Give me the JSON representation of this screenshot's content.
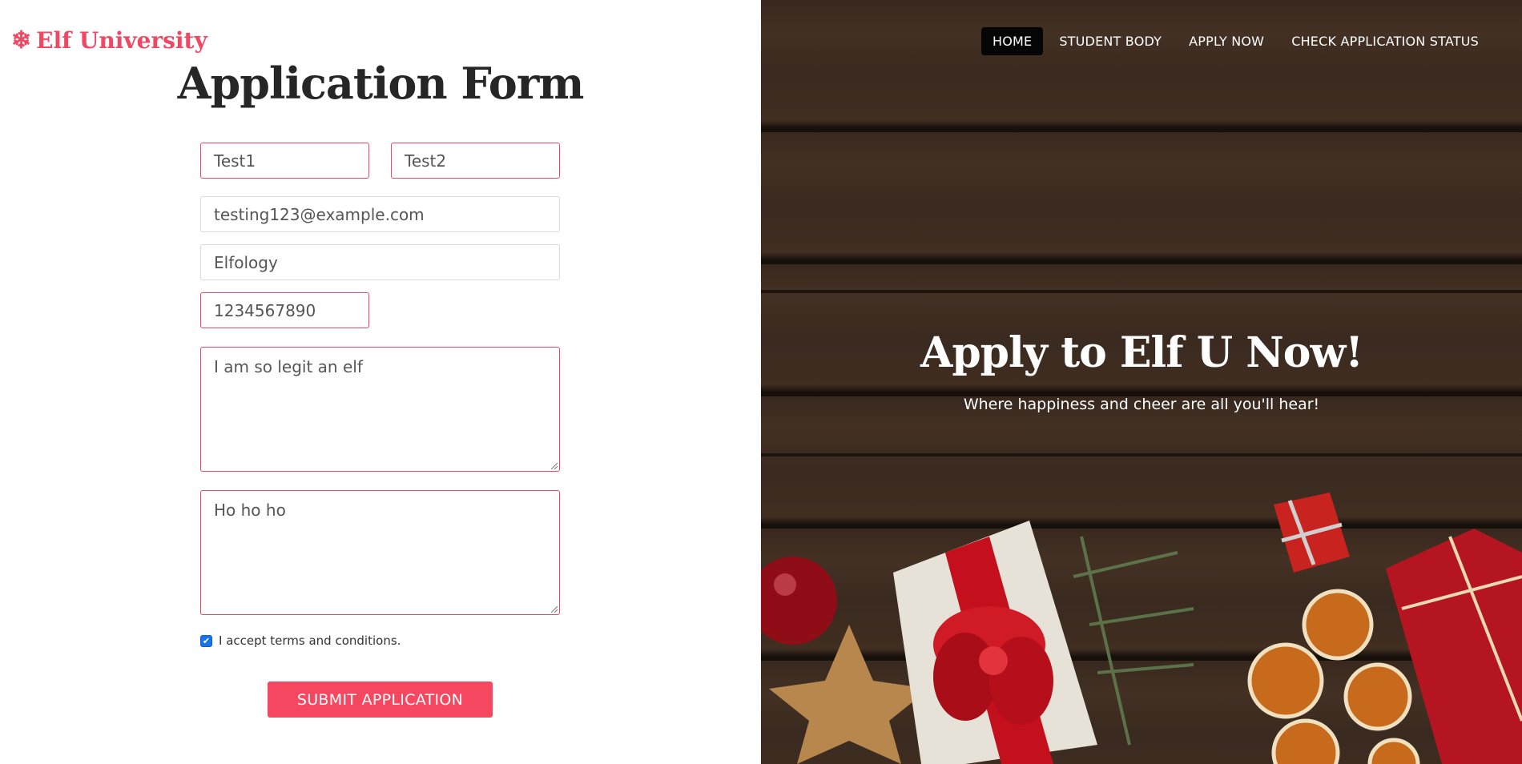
{
  "brand": {
    "name": "Elf University",
    "icon": "snowflake-icon"
  },
  "form": {
    "title": "Application Form",
    "first_name": "Test1",
    "last_name": "Test2",
    "email": "testing123@example.com",
    "program": "Elfology",
    "phone": "1234567890",
    "why_textarea": "I am so legit an elf",
    "essay_textarea": "Ho ho ho",
    "terms_label": "I accept terms and conditions.",
    "terms_checked": true,
    "submit_label": "SUBMIT APPLICATION"
  },
  "nav": {
    "items": [
      {
        "label": "HOME",
        "active": true
      },
      {
        "label": "STUDENT BODY",
        "active": false
      },
      {
        "label": "APPLY NOW",
        "active": false
      },
      {
        "label": "CHECK APPLICATION STATUS",
        "active": false
      }
    ]
  },
  "hero": {
    "title": "Apply to Elf U Now!",
    "subtitle": "Where happiness and cheer are all you'll hear!"
  },
  "colors": {
    "accent": "#f5475f",
    "invalid_border": "#e84a63",
    "nav_active_bg": "#050505"
  }
}
